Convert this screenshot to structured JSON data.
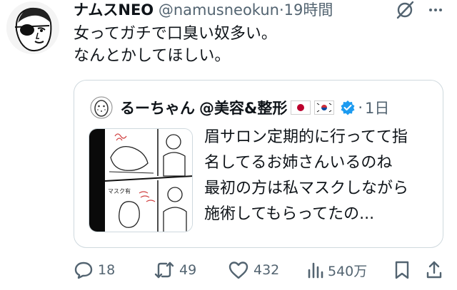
{
  "tweet": {
    "display_name": "ナムスNEO",
    "handle": "@namusneokun",
    "separator": "·",
    "time": "19時間",
    "lines": [
      "女ってガチで口臭い奴多い。",
      "なんとかしてほしい。"
    ]
  },
  "quote": {
    "display_name": "るーちゃん",
    "handle_part": "@美容&整形",
    "separator": "·",
    "time": "1日",
    "lines": [
      "眉サロン定期的に行ってて指",
      "名してるお姉さんいるのね",
      "最初の方は私マスクしながら",
      "施術してもらってたの..."
    ],
    "image_caption": "マスク有"
  },
  "actions": {
    "reply_count": "18",
    "retweet_count": "49",
    "like_count": "432",
    "views_count": "540万"
  },
  "colors": {
    "text": "#0f1419",
    "secondary": "#536471",
    "border": "#cfd9de",
    "verified": "#1d9bf0"
  }
}
